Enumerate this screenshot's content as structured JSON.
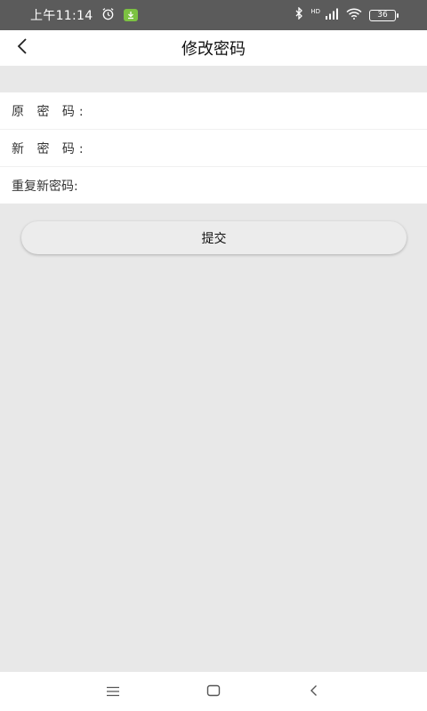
{
  "status_bar": {
    "time": "上午11:14",
    "network_label": "HD",
    "battery": "36"
  },
  "header": {
    "title": "修改密码"
  },
  "form": {
    "fields": [
      {
        "label": "原 密 码:",
        "value": ""
      },
      {
        "label": "新 密 码:",
        "value": ""
      },
      {
        "label": "重复新密码:",
        "value": ""
      }
    ]
  },
  "submit": {
    "label": "提交"
  },
  "icons": {
    "back": "back-chevron-icon",
    "alarm": "alarm-icon",
    "download": "download-icon",
    "bluetooth": "bluetooth-icon",
    "signal": "signal-icon",
    "wifi": "wifi-icon",
    "battery": "battery-icon",
    "nav_menu": "menu-icon",
    "nav_home": "home-icon",
    "nav_back": "back-icon"
  },
  "colors": {
    "status_bar": "#5b5b5b",
    "page_background": "#e8e8e8",
    "download_badge": "#7cc242"
  }
}
